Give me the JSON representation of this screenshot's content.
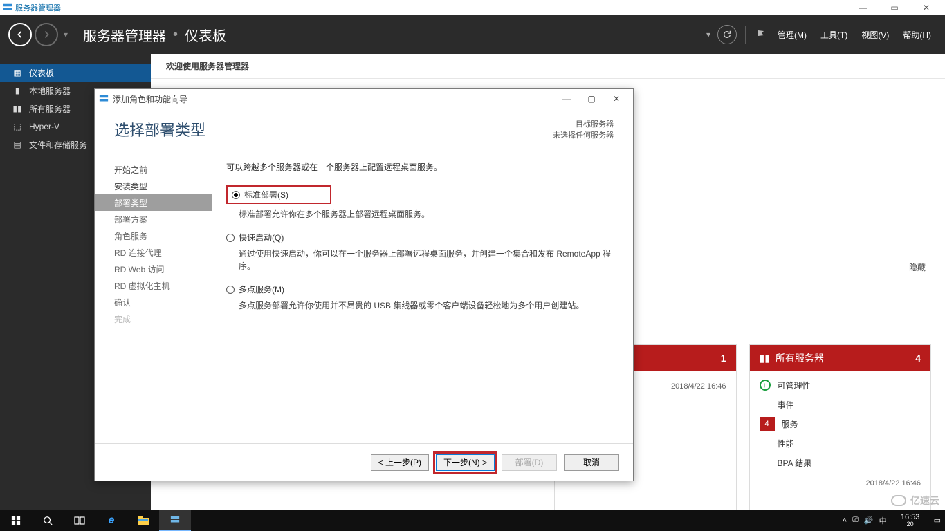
{
  "window": {
    "title": "服务器管理器"
  },
  "window_controls_outer": {
    "min": "—",
    "max": "▭",
    "close": "✕"
  },
  "header": {
    "breadcrumb_app": "服务器管理器",
    "breadcrumb_page": "仪表板",
    "menu": {
      "manage": "管理(M)",
      "tools": "工具(T)",
      "view": "视图(V)",
      "help": "帮助(H)"
    }
  },
  "sidebar": {
    "items": [
      {
        "label": "仪表板",
        "icon": "dashboard-icon"
      },
      {
        "label": "本地服务器",
        "icon": "server-icon"
      },
      {
        "label": "所有服务器",
        "icon": "servers-icon"
      },
      {
        "label": "Hyper-V",
        "icon": "hyperv-icon"
      },
      {
        "label": "文件和存储服务",
        "icon": "storage-icon"
      }
    ],
    "chevron": "▸"
  },
  "content": {
    "welcome": "欢迎使用服务器管理器",
    "hide": "隐藏"
  },
  "tiles": {
    "left_badge": "1",
    "right": {
      "title": "所有服务器",
      "count": "4",
      "rows": [
        {
          "kind": "ok",
          "label": "可管理性"
        },
        {
          "kind": "plain",
          "label": "事件"
        },
        {
          "kind": "num",
          "num": "4",
          "label": "服务"
        },
        {
          "kind": "plain",
          "label": "性能"
        },
        {
          "kind": "plain",
          "label": "BPA 结果"
        }
      ],
      "footer_time": "2018/4/22 16:46"
    },
    "left_footer_time": "2018/4/22 16:46"
  },
  "wizard": {
    "title": "添加角色和功能向导",
    "heading": "选择部署类型",
    "target_label": "目标服务器",
    "target_value": "未选择任何服务器",
    "steps": [
      {
        "label": "开始之前",
        "state": "done"
      },
      {
        "label": "安装类型",
        "state": "done"
      },
      {
        "label": "部署类型",
        "state": "active"
      },
      {
        "label": "部署方案",
        "state": "pending"
      },
      {
        "label": "角色服务",
        "state": "pending"
      },
      {
        "label": "RD 连接代理",
        "state": "pending"
      },
      {
        "label": "RD Web 访问",
        "state": "pending"
      },
      {
        "label": "RD 虚拟化主机",
        "state": "pending"
      },
      {
        "label": "确认",
        "state": "pending"
      },
      {
        "label": "完成",
        "state": "disabled"
      }
    ],
    "intro": "可以跨越多个服务器或在一个服务器上配置远程桌面服务。",
    "options": [
      {
        "title": "标准部署(S)",
        "checked": true,
        "highlight": true,
        "desc": "标准部署允许你在多个服务器上部署远程桌面服务。"
      },
      {
        "title": "快速启动(Q)",
        "checked": false,
        "highlight": false,
        "desc": "通过使用快速启动，你可以在一个服务器上部署远程桌面服务，并创建一个集合和发布 RemoteApp 程序。"
      },
      {
        "title": "多点服务(M)",
        "checked": false,
        "highlight": false,
        "desc": "多点服务部署允许你使用并不昂贵的 USB 集线器或零个客户端设备轻松地为多个用户创建站。"
      }
    ],
    "buttons": {
      "prev": "< 上一步(P)",
      "next": "下一步(N) >",
      "deploy": "部署(D)",
      "cancel": "取消"
    },
    "controls": {
      "min": "—",
      "max": "▢",
      "close": "✕"
    }
  },
  "taskbar": {
    "clock_top": "16:53",
    "clock_bottom": "20",
    "ime": "中",
    "tray_icons": [
      "˄",
      "⎚",
      "🔊"
    ]
  },
  "watermark": "亿速云"
}
